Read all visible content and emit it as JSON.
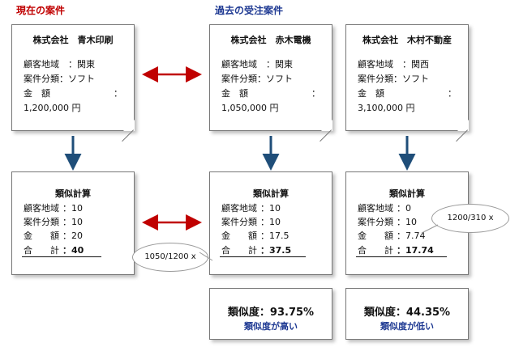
{
  "headings": {
    "current": "現在の案件",
    "past": "過去の受注案件"
  },
  "cases": [
    {
      "company": "株式会社　青木印刷",
      "region_label": "顧客地域",
      "region_value": "：関東",
      "category_label": "案件分類",
      "category_value": "：ソフト",
      "amount_label": "金　額",
      "amount_colon": "：",
      "amount_value": "1,200,000 円"
    },
    {
      "company": "株式会社　赤木電機",
      "region_label": "顧客地域",
      "region_value": "：関東",
      "category_label": "案件分類",
      "category_value": "：ソフト",
      "amount_label": "金　額",
      "amount_colon": "：",
      "amount_value": "1,050,000 円"
    },
    {
      "company": "株式会社　木村不動産",
      "region_label": "顧客地域",
      "region_value": "：関西",
      "category_label": "案件分類",
      "category_value": "：ソフト",
      "amount_label": "金　額",
      "amount_colon": "：",
      "amount_value": "3,100,000 円"
    }
  ],
  "calcs": [
    {
      "title": "類似計算",
      "region_label": "顧客地域",
      "region_value": "：10",
      "category_label": "案件分類",
      "category_value": "：10",
      "amount_label": "金　　額",
      "amount_value": "：20",
      "total_label": "合　　計",
      "total_value": "：40"
    },
    {
      "title": "類似計算",
      "region_label": "顧客地域",
      "region_value": "：10",
      "category_label": "案件分類",
      "category_value": "：10",
      "amount_label": "金　　額",
      "amount_value": "：17.5",
      "total_label": "合　　計",
      "total_value": "：37.5"
    },
    {
      "title": "類似計算",
      "region_label": "顧客地域",
      "region_value": "：0",
      "category_label": "案件分類",
      "category_value": "：10",
      "amount_label": "金　　額",
      "amount_value": "：7.74",
      "total_label": "合　　計",
      "total_value": "：17.74"
    }
  ],
  "bubbles": {
    "first": "1050/1200 x",
    "second": "1200/310 x"
  },
  "results": [
    {
      "degree": "類似度：93.75%",
      "verdict": "類似度が高い"
    },
    {
      "degree": "類似度：44.35%",
      "verdict": "類似度が低い"
    }
  ],
  "colors": {
    "red_arrow": "#c00000",
    "blue_arrow": "#1f4e79",
    "heading_red": "#c00000",
    "heading_blue": "#1f3a93"
  }
}
